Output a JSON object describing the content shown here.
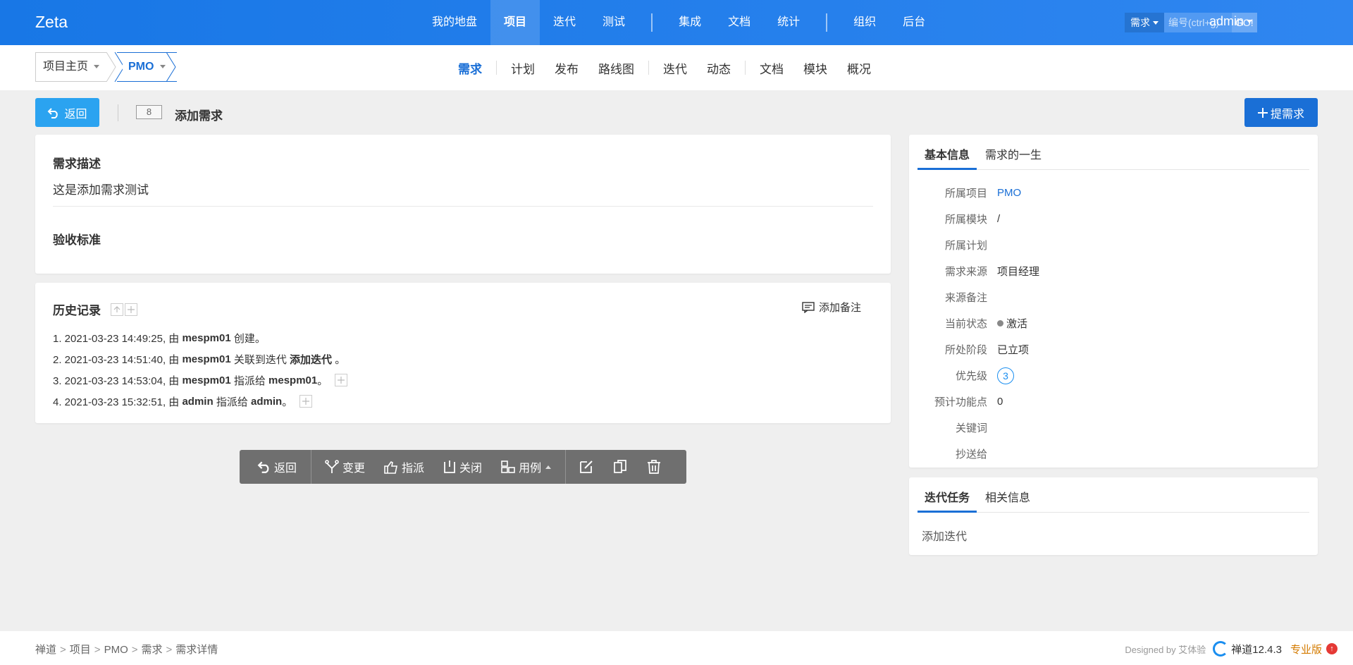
{
  "header": {
    "brand": "Zeta",
    "nav": [
      {
        "label": "我的地盘",
        "active": false
      },
      {
        "label": "项目",
        "active": true
      },
      {
        "label": "迭代",
        "active": false
      },
      {
        "label": "测试",
        "active": false
      },
      {
        "sep": true
      },
      {
        "label": "集成",
        "active": false
      },
      {
        "label": "文档",
        "active": false
      },
      {
        "label": "统计",
        "active": false
      },
      {
        "sep": true
      },
      {
        "label": "组织",
        "active": false
      },
      {
        "label": "后台",
        "active": false
      }
    ],
    "search": {
      "type": "需求",
      "placeholder": "编号(ctrl+g)",
      "go": "GO!"
    },
    "user": "admin"
  },
  "subnav": {
    "home": "项目主页",
    "project": "PMO",
    "menu": [
      {
        "label": "需求",
        "active": true
      },
      {
        "sep": true
      },
      {
        "label": "计划"
      },
      {
        "label": "发布"
      },
      {
        "label": "路线图"
      },
      {
        "sep": true
      },
      {
        "label": "迭代"
      },
      {
        "label": "动态"
      },
      {
        "sep": true
      },
      {
        "label": "文档"
      },
      {
        "label": "模块"
      },
      {
        "label": "概况"
      }
    ]
  },
  "titlebar": {
    "back": "返回",
    "id": "8",
    "title": "添加需求",
    "add": "提需求"
  },
  "desc": {
    "title": "需求描述",
    "text": "这是添加需求测试",
    "verify_title": "验收标准"
  },
  "history": {
    "title": "历史记录",
    "add_note": "添加备注",
    "items": [
      [
        {
          "t": "1. 2021-03-23 14:49:25, 由 "
        },
        {
          "t": "mespm01",
          "b": true
        },
        {
          "t": " 创建。"
        }
      ],
      [
        {
          "t": "2. 2021-03-23 14:51:40, 由 "
        },
        {
          "t": "mespm01",
          "b": true
        },
        {
          "t": " 关联到迭代 "
        },
        {
          "t": "添加迭代",
          "b": true
        },
        {
          "t": " 。"
        }
      ],
      [
        {
          "t": "3. 2021-03-23 14:53:04, 由 "
        },
        {
          "t": "mespm01",
          "b": true
        },
        {
          "t": " 指派给 "
        },
        {
          "t": "mespm01",
          "b": true
        },
        {
          "t": "。"
        },
        {
          "plus": true
        }
      ],
      [
        {
          "t": "4. 2021-03-23 15:32:51, 由 "
        },
        {
          "t": "admin",
          "b": true
        },
        {
          "t": " 指派给 "
        },
        {
          "t": "admin",
          "b": true
        },
        {
          "t": "。"
        },
        {
          "plus": true
        }
      ]
    ]
  },
  "actions": {
    "back": "返回",
    "change": "变更",
    "assign": "指派",
    "close": "关闭",
    "cases": "用例"
  },
  "info": {
    "tabs": [
      "基本信息",
      "需求的一生"
    ],
    "rows": [
      {
        "k": "所属项目",
        "v": "PMO",
        "link": true
      },
      {
        "k": "所属模块",
        "v": "/"
      },
      {
        "k": "所属计划",
        "v": ""
      },
      {
        "k": "需求来源",
        "v": "项目经理"
      },
      {
        "k": "来源备注",
        "v": ""
      },
      {
        "k": "当前状态",
        "v": "激活",
        "dot": true
      },
      {
        "k": "所处阶段",
        "v": "已立项"
      },
      {
        "k": "优先级",
        "v": "3",
        "pri": true
      },
      {
        "k": "预计功能点",
        "v": "0"
      },
      {
        "k": "关键词",
        "v": ""
      },
      {
        "k": "抄送给",
        "v": ""
      }
    ]
  },
  "iter": {
    "tabs": [
      "迭代任务",
      "相关信息"
    ],
    "link": "添加迭代"
  },
  "footer": {
    "breadcrumbs": [
      "禅道",
      "项目",
      "PMO",
      "需求",
      "需求详情"
    ],
    "designed": "Designed by 艾体验",
    "version": "禅道12.4.3",
    "edition": "专业版"
  },
  "colors": {
    "primary": "#1a6fd6",
    "header": "#1877e6",
    "toolbar": "#6f6f6f"
  }
}
